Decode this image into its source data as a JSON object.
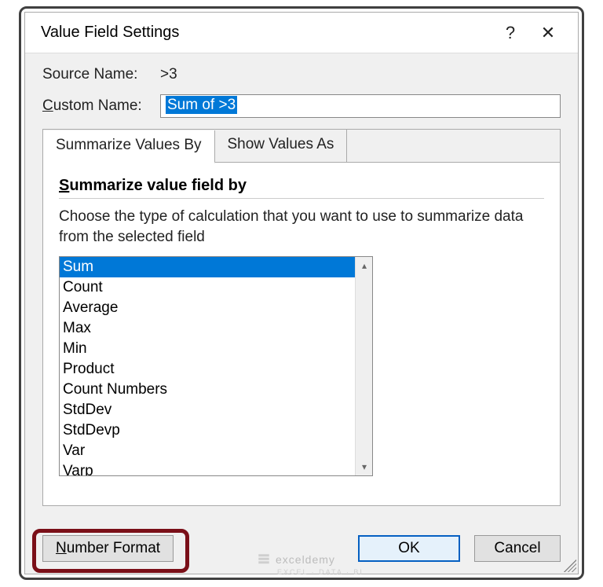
{
  "dialog": {
    "title": "Value Field Settings",
    "help_glyph": "?",
    "close_glyph": "✕"
  },
  "source": {
    "label": "Source Name:",
    "value": ">3"
  },
  "custom": {
    "label_pre": "C",
    "label_post": "ustom Name:",
    "value": "Sum of >3"
  },
  "tabs": {
    "summarize": "Summarize Values By",
    "show": "Show Values As"
  },
  "section": {
    "title_pre": "S",
    "title_post": "ummarize value field by",
    "hint": "Choose the type of calculation that you want to use to summarize data from the selected field"
  },
  "list": {
    "items": [
      "Sum",
      "Count",
      "Average",
      "Max",
      "Min",
      "Product",
      "Count Numbers",
      "StdDev",
      "StdDevp",
      "Var",
      "Varp"
    ],
    "selected_index": 0
  },
  "buttons": {
    "number_format_pre": "N",
    "number_format_post": "umber Format",
    "ok": "OK",
    "cancel": "Cancel"
  },
  "scroll": {
    "up": "▴",
    "down": "▾"
  },
  "watermark": {
    "main": "exceldemy",
    "sub": "EXCEL · DATA · BI"
  }
}
